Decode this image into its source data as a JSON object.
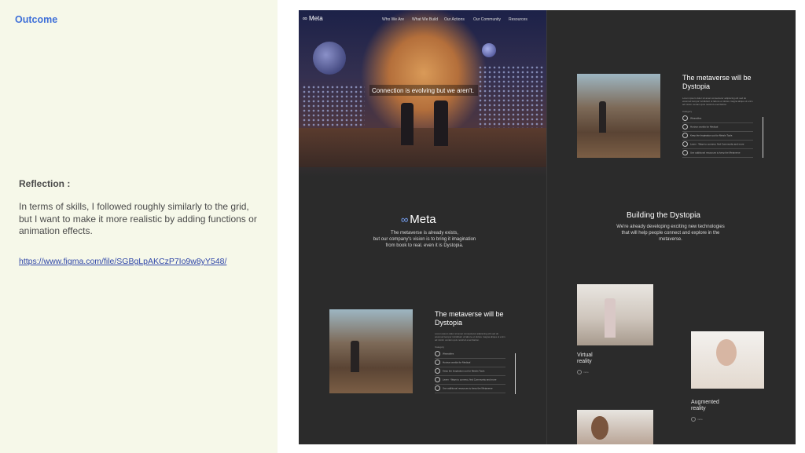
{
  "left": {
    "title": "Outcome",
    "reflection_heading": "Reflection :",
    "reflection_text": "In terms of skills, I followed roughly similarly to the grid, but I want to make it more realistic by adding functions or animation effects.",
    "link": "https://www.figma.com/file/SGBgLpAKCzP7Io9w8yY548/"
  },
  "mock": {
    "brand": "Meta",
    "nav": [
      "Who We Are",
      "What We Build",
      "Our Actions",
      "Our Community",
      "Resources"
    ],
    "hero_caption": "Connection is evolving but we aren't.",
    "meta_logo": "Meta",
    "meta_sub": [
      "The metaverse is already exists,",
      "but our company's vision is to bring it imagination",
      "from book to real. even it is Dystopia."
    ],
    "card_title_line1": "The metaverse will be",
    "card_title_line2": "Dystopia",
    "card_list": [
      "Wearables",
      "Horizon worlds for Medical",
      "Keep the Inspiration out for Meta's Tools",
      "Learn · Ways to connect, find Community and more",
      "Use additional resources to keep the Metaverse"
    ],
    "card_lorem": "Lorem ipsum dolor sit amet consectetur adipiscing elit sed do eiusmod tempor incididunt ut labore et dolore magna aliqua ut enim ad minim veniam quis nostrud exercitation.",
    "card_list_label": "Category",
    "building_title": "Building the Dystopia",
    "building_sub": [
      "We're already developing exciting new technologies",
      "that will help people connect and explore in the",
      "metaverse."
    ],
    "virtual_label": [
      "Virtual",
      "reality"
    ],
    "augmented_label": [
      "Augmented",
      "reality"
    ],
    "more": "more"
  }
}
